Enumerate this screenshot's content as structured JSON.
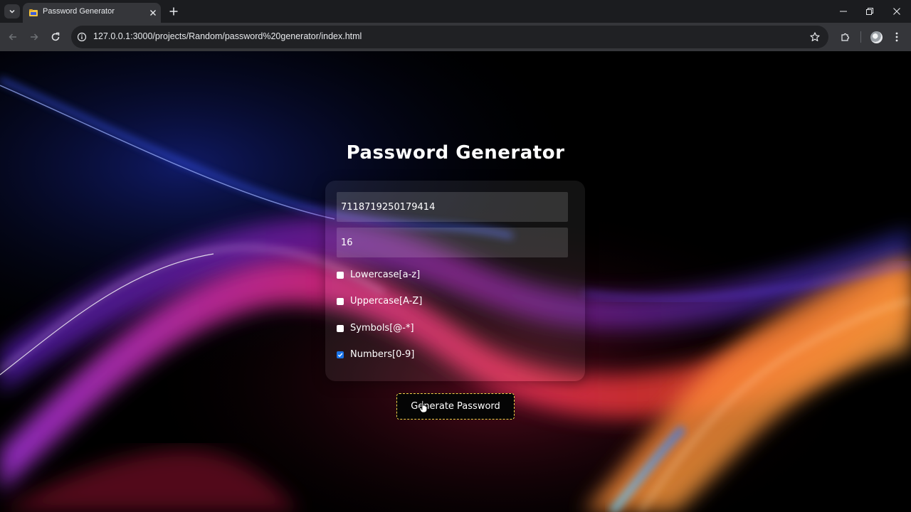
{
  "browser": {
    "tab_title": "Password Generator",
    "url": "127.0.0.1:3000/projects/Random/password%20generator/index.html",
    "icons": {
      "tab_list": "chevron-down-icon",
      "favicon": "folder-favicon-icon",
      "tab_close": "close-icon",
      "new_tab": "plus-icon",
      "back": "back-arrow-icon",
      "forward": "forward-arrow-icon",
      "reload": "reload-icon",
      "site_info": "info-icon",
      "bookmark": "star-icon",
      "extensions": "puzzle-icon",
      "profile": "avatar",
      "menu": "kebab-menu-icon",
      "minimize": "minimize-icon",
      "restore": "restore-icon",
      "close_window": "close-icon"
    }
  },
  "app": {
    "title": "Password Generator",
    "password_value": "7118719250179414",
    "length_value": "16",
    "options": [
      {
        "label": "Lowercase[a-z]",
        "checked": false
      },
      {
        "label": "Uppercase[A-Z]",
        "checked": false
      },
      {
        "label": "Symbols[@-*]",
        "checked": false
      },
      {
        "label": "Numbers[0-9]",
        "checked": true
      }
    ],
    "generate_label": "Generate Password",
    "colors": {
      "button_border": "#f1d54a",
      "checkbox_checked": "#1a73e8",
      "background": "#000000"
    }
  }
}
